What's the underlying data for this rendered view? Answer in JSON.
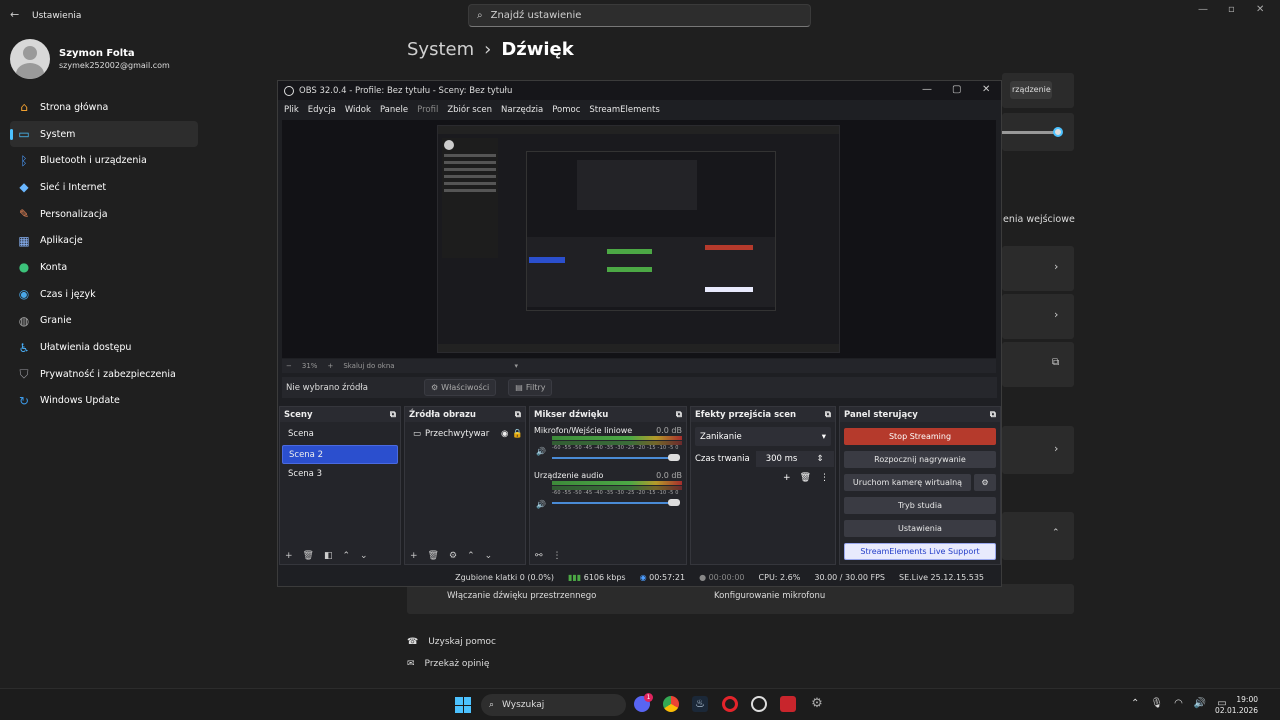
{
  "settings": {
    "app_title": "Ustawienia",
    "search_placeholder": "Znajdź ustawienie",
    "user": {
      "name": "Szymon Folta",
      "email": "szymek252002@gmail.com"
    },
    "breadcrumb": {
      "parent": "System",
      "sep": "›",
      "current": "Dźwięk"
    },
    "nav": [
      {
        "label": "Strona główna",
        "icon": "home-icon",
        "color": "#f0a030"
      },
      {
        "label": "System",
        "icon": "monitor-icon",
        "color": "#4cc2ff",
        "active": true
      },
      {
        "label": "Bluetooth i urządzenia",
        "icon": "bluetooth-icon",
        "color": "#4c9dff"
      },
      {
        "label": "Sieć i Internet",
        "icon": "wifi-icon",
        "color": "#6ab7ff"
      },
      {
        "label": "Personalizacja",
        "icon": "brush-icon",
        "color": "#f08a5a"
      },
      {
        "label": "Aplikacje",
        "icon": "apps-icon",
        "color": "#8ab4f8"
      },
      {
        "label": "Konta",
        "icon": "person-icon",
        "color": "#3cc27a"
      },
      {
        "label": "Czas i język",
        "icon": "globe-icon",
        "color": "#4aa8e8"
      },
      {
        "label": "Granie",
        "icon": "gamepad-icon",
        "color": "#aaaaaa"
      },
      {
        "label": "Ułatwienia dostępu",
        "icon": "accessibility-icon",
        "color": "#4ab4ff"
      },
      {
        "label": "Prywatność i zabezpieczenia",
        "icon": "shield-icon",
        "color": "#9a9aa0"
      },
      {
        "label": "Windows Update",
        "icon": "update-icon",
        "color": "#3d9ae8"
      }
    ],
    "bg_fragments": {
      "device": "rządzenie",
      "input": "enia wejściowe",
      "spatial": "Włączanie dźwięku przestrzennego",
      "mic": "Konfigurowanie mikrofonu"
    },
    "help": {
      "get_help": "Uzyskaj pomoc",
      "feedback": "Przekaż opinię"
    }
  },
  "obs": {
    "title": "OBS 32.0.4 - Profile: Bez tytułu - Sceny: Bez tytułu",
    "menu": [
      "Plik",
      "Edycja",
      "Widok",
      "Panele",
      "Profil",
      "Zbiór scen",
      "Narzędzia",
      "Pomoc",
      "StreamElements"
    ],
    "menu_disabled": "Profil",
    "zoom": {
      "minus": "−",
      "value": "31%",
      "plus": "+",
      "fit": "Skaluj do okna"
    },
    "source_bar": {
      "none": "Nie wybrano źródła",
      "properties": "Właściwości",
      "filters": "Filtry"
    },
    "docks": {
      "scenes": {
        "title": "Sceny",
        "items": [
          "Scena",
          "Scena 2",
          "Scena 3"
        ],
        "selected": 1
      },
      "sources": {
        "title": "Źródła obrazu",
        "items": [
          "Przechwytywar"
        ]
      },
      "mixer": {
        "title": "Mikser dźwięku",
        "channels": [
          {
            "name": "Mikrofon/Wejście liniowe",
            "db": "0.0 dB"
          },
          {
            "name": "Urządzenie audio",
            "db": "0.0 dB"
          }
        ],
        "scale": "-60 -55 -50 -45 -40 -35 -30 -25 -20 -15 -10 -5 0"
      },
      "transitions": {
        "title": "Efekty przejścia scen",
        "type": "Zanikanie",
        "duration_label": "Czas trwania",
        "duration": "300 ms"
      },
      "controls": {
        "title": "Panel sterujący",
        "buttons": [
          "Stop Streaming",
          "Rozpocznij nagrywanie",
          "Uruchom kamerę wirtualną",
          "Tryb studia",
          "Ustawienia",
          "StreamElements Live Support"
        ]
      }
    },
    "status": {
      "dropped": "Zgubione klatki 0 (0.0%)",
      "bitrate": "6106 kbps",
      "stream_time": "00:57:21",
      "rec_time": "00:00:00",
      "cpu": "CPU: 2.6%",
      "fps": "30.00 / 30.00 FPS",
      "version": "SE.Live 25.12.15.535"
    }
  },
  "taskbar": {
    "search": "Wyszukaj",
    "time": "19:00",
    "date": "02.01.2026",
    "discord_badge": "1"
  }
}
